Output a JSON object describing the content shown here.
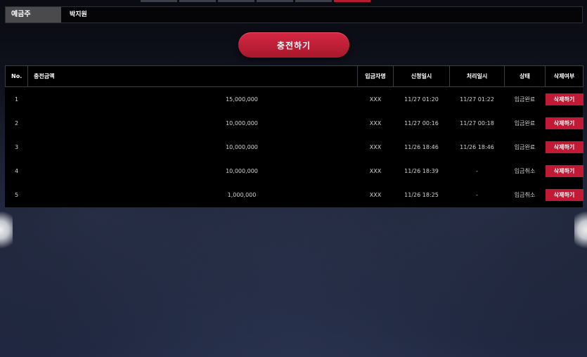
{
  "depositor": {
    "label": "예금주",
    "value": "박지원"
  },
  "charge_button": "충전하기",
  "table": {
    "headers": {
      "no": "No.",
      "amount": "충전금액",
      "depositor_name": "입금자명",
      "request_time": "신청일시",
      "processed_time": "처리일시",
      "status": "상태",
      "delete": "삭제여부"
    },
    "rows": [
      {
        "no": "1",
        "amount": "15,000,000",
        "depositor_name": "XXX",
        "request_time": "11/27 01:20",
        "processed_time": "11/27 01:22",
        "status": "입금완료",
        "delete_label": "삭제하기"
      },
      {
        "no": "2",
        "amount": "10,000,000",
        "depositor_name": "XXX",
        "request_time": "11/27 00:16",
        "processed_time": "11/27 00:18",
        "status": "입금완료",
        "delete_label": "삭제하기"
      },
      {
        "no": "3",
        "amount": "10,000,000",
        "depositor_name": "XXX",
        "request_time": "11/26 18:46",
        "processed_time": "11/26 18:46",
        "status": "입금완료",
        "delete_label": "삭제하기"
      },
      {
        "no": "4",
        "amount": "10,000,000",
        "depositor_name": "XXX",
        "request_time": "11/26 18:39",
        "processed_time": "-",
        "status": "입금취소",
        "delete_label": "삭제하기"
      },
      {
        "no": "5",
        "amount": "1,000,000",
        "depositor_name": "XXX",
        "request_time": "11/26 18:25",
        "processed_time": "-",
        "status": "입금취소",
        "delete_label": "삭제하기"
      }
    ]
  }
}
